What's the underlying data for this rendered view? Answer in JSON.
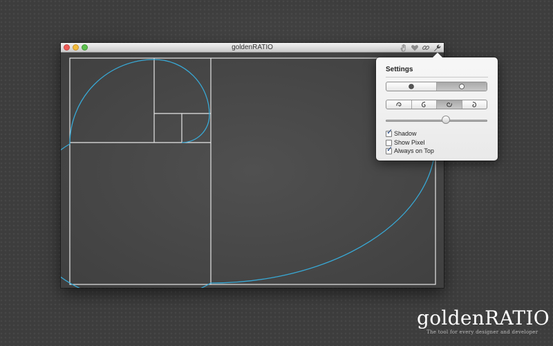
{
  "window": {
    "title": "goldenRATIO",
    "traffic_lights": {
      "close": "#ee5b57",
      "minimize": "#f2bb3b",
      "zoom": "#5dc04e"
    },
    "toolbar_icons": [
      "hand-icon",
      "heart-icon",
      "link-icon",
      "wrench-icon"
    ]
  },
  "canvas": {
    "line_color": "#e6e6e6",
    "spiral_color": "#38a9d6"
  },
  "settings": {
    "title": "Settings",
    "color_mode": {
      "options": [
        "dark-dot-icon",
        "light-circle-icon"
      ],
      "selected": 1
    },
    "spiral_orientation": {
      "options": [
        "spiral-orientation-1-icon",
        "spiral-orientation-2-icon",
        "spiral-orientation-3-icon",
        "spiral-orientation-4-icon"
      ],
      "selected": 2
    },
    "opacity_slider": {
      "value": 0.6
    },
    "checkboxes": [
      {
        "label": "Shadow",
        "checked": true
      },
      {
        "label": "Show Pixel",
        "checked": false
      },
      {
        "label": "Always on Top",
        "checked": true
      }
    ]
  },
  "branding": {
    "name": "goldenRATIO",
    "tagline": "The tool for every designer and developer"
  }
}
